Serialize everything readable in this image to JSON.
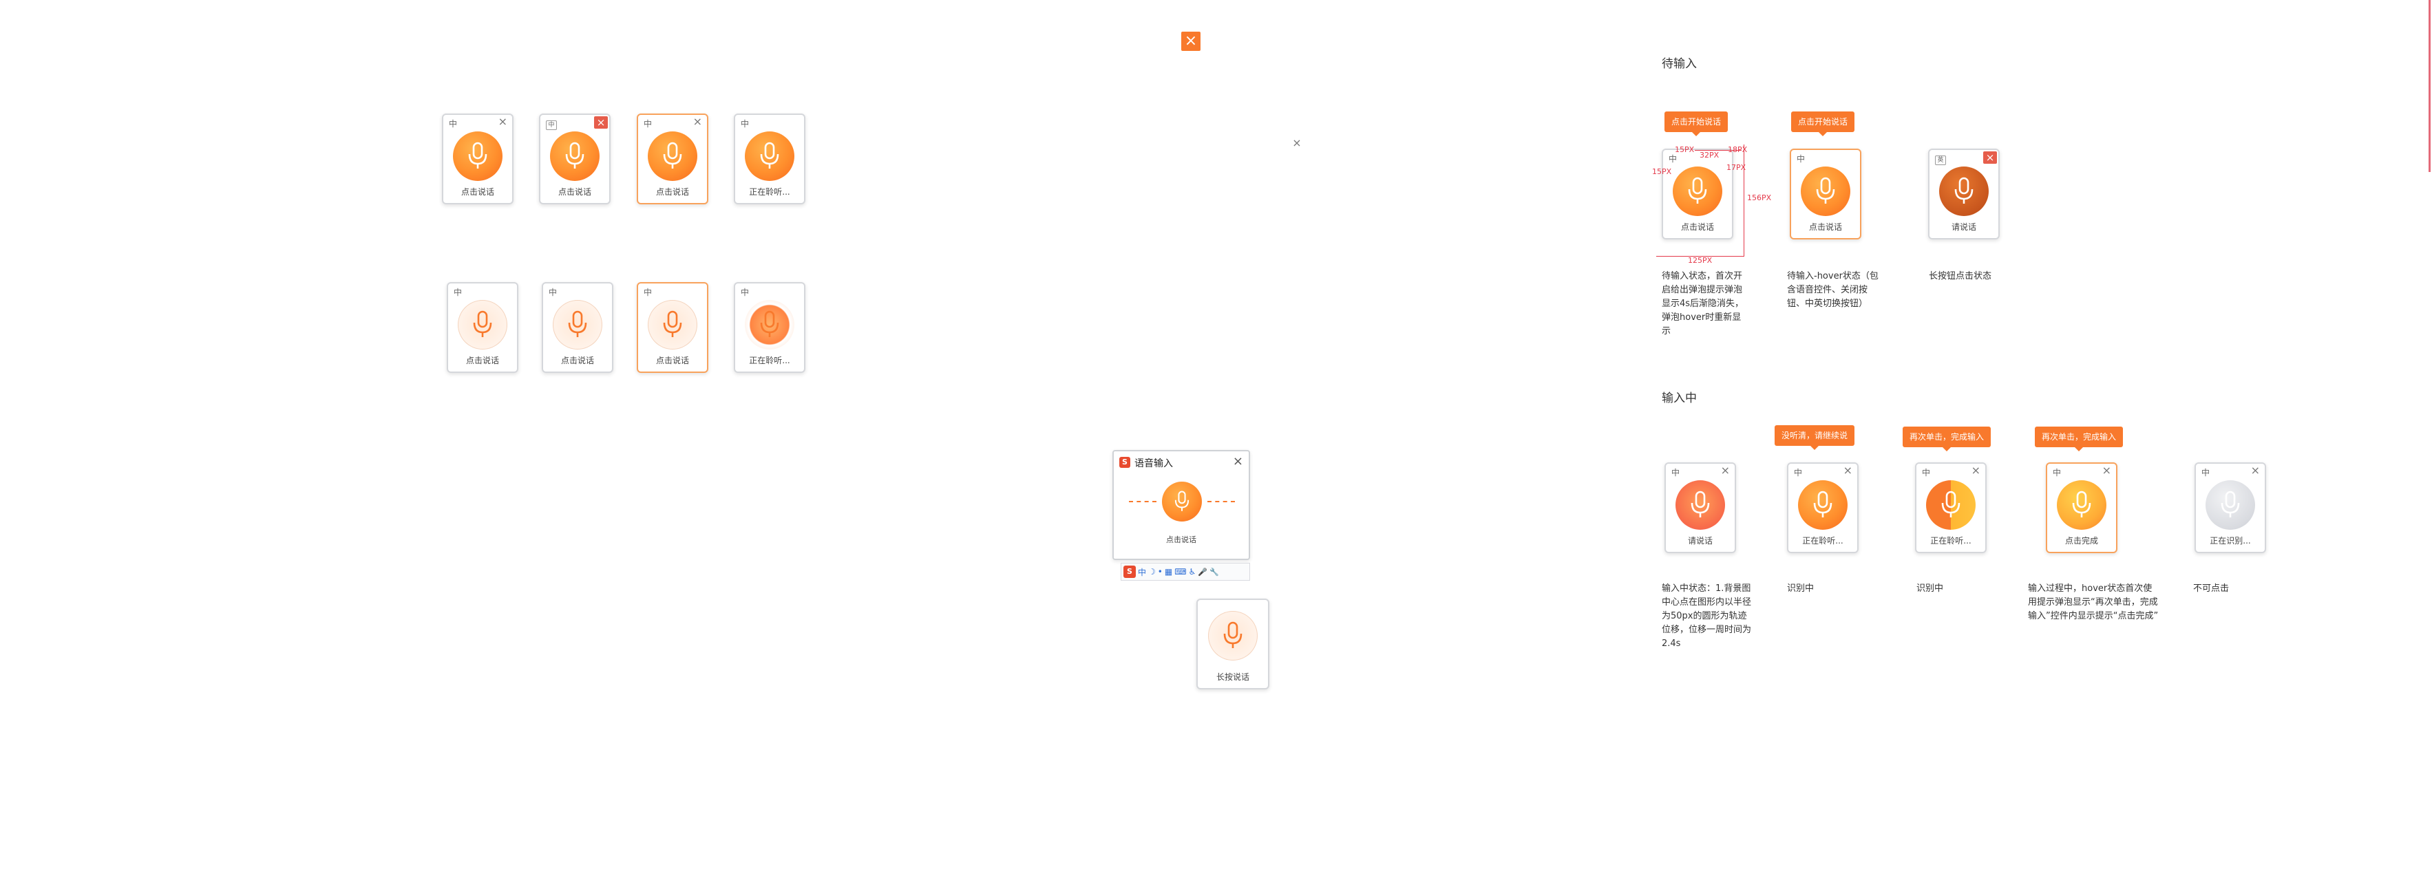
{
  "left_grid": {
    "row1": [
      {
        "ch": "中",
        "label": "点击说话",
        "close": "x"
      },
      {
        "ch": "中",
        "label": "点击说话",
        "close": "red"
      },
      {
        "ch": "中",
        "label": "点击说话",
        "close": "x",
        "highlight": true
      },
      {
        "ch": "中",
        "label": "正在聆听...",
        "close": "none"
      }
    ],
    "row2": [
      {
        "ch": "中",
        "label": "点击说话"
      },
      {
        "ch": "中",
        "label": "点击说话"
      },
      {
        "ch": "中",
        "label": "点击说话",
        "highlight": true
      },
      {
        "ch": "中",
        "label": "正在聆听..."
      }
    ]
  },
  "standalone": {
    "close_red": "×",
    "close_plain": "×"
  },
  "voice_window": {
    "title": "语音输入",
    "close": "×",
    "label": "点击说话",
    "toolbar_items": [
      "S",
      "中",
      "☽",
      "•",
      "▦",
      "⌨",
      "♿",
      "🎤",
      "🔧"
    ]
  },
  "long_press": {
    "label": "长按说话"
  },
  "sections": {
    "waiting": {
      "title": "待输入",
      "tags": [
        "点击开始说话",
        "点击开始说话"
      ],
      "cards": [
        {
          "ch": "中",
          "label": "点击说话"
        },
        {
          "ch": "中",
          "label": "点击说话"
        },
        {
          "ch": "英",
          "label": "请说话"
        }
      ],
      "dims": {
        "w15a": "15PX",
        "w32": "32PX",
        "w18": "18PX",
        "w15b": "15PX",
        "w17": "17PX",
        "h156": "156PX",
        "w125": "125PX"
      },
      "descs": [
        "待输入状态，首次开启给出弹泡提示弹泡显示4s后渐隐消失，弹泡hover时重新显示",
        "待输入-hover状态（包含语音控件、关闭按钮、中英切换按钮）",
        "长按钮点击状态"
      ]
    },
    "inputting": {
      "title": "输入中",
      "tags": [
        "没听清，请继续说",
        "再次单击，完成输入",
        "再次单击，完成输入"
      ],
      "cards": [
        {
          "ch": "中",
          "label": "请说话"
        },
        {
          "ch": "中",
          "label": "正在聆听..."
        },
        {
          "ch": "中",
          "label": "正在聆听..."
        },
        {
          "ch": "中",
          "label": "点击完成"
        },
        {
          "ch": "中",
          "label": "正在识别..."
        }
      ],
      "descs": [
        "输入中状态：1.背景图中心点在图形内以半径为50px的圆形为轨迹位移，位移一周时间为2.4s",
        "识别中",
        "识别中",
        "输入过程中，hover状态首次使用提示弹泡显示“再次单击，完成输入”控件内显示提示“点击完成”",
        "不可点击"
      ]
    }
  },
  "colors": {
    "accent": "#f8792c",
    "red": "#e65d4b",
    "dim": "#e4394a"
  }
}
